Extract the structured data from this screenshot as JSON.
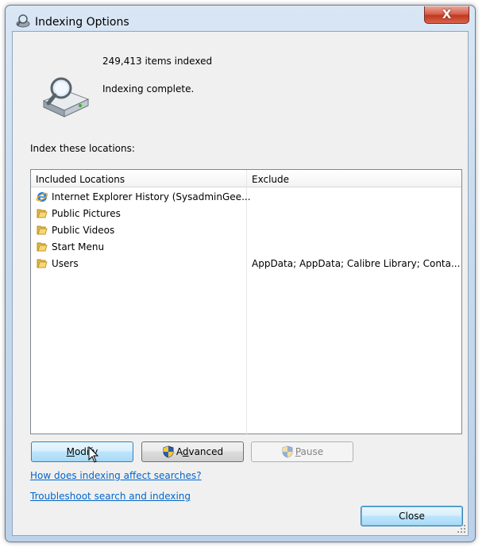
{
  "window": {
    "title": "Indexing Options",
    "close_glyph": "X"
  },
  "status": {
    "items_indexed": "249,413 items indexed",
    "message": "Indexing complete."
  },
  "locations_label": "Index these locations:",
  "table": {
    "columns": [
      "Included Locations",
      "Exclude"
    ],
    "rows": [
      {
        "icon": "ie-icon",
        "name": "Internet Explorer History (SysadminGee...",
        "exclude": ""
      },
      {
        "icon": "folder-icon",
        "name": "Public Pictures",
        "exclude": ""
      },
      {
        "icon": "folder-icon",
        "name": "Public Videos",
        "exclude": ""
      },
      {
        "icon": "folder-icon",
        "name": "Start Menu",
        "exclude": ""
      },
      {
        "icon": "folder-icon",
        "name": "Users",
        "exclude": "AppData; AppData; Calibre Library; Conta..."
      }
    ]
  },
  "buttons": {
    "modify_pre": "",
    "modify_u": "M",
    "modify_post": "odify",
    "advanced_pre": "A",
    "advanced_u": "d",
    "advanced_post": "vanced",
    "pause_pre": "",
    "pause_u": "P",
    "pause_post": "ause",
    "close": "Close"
  },
  "links": {
    "how": "How does indexing affect searches?",
    "troubleshoot": "Troubleshoot search and indexing"
  },
  "colors": {
    "link": "#0066cc",
    "close_button": "#c2381f",
    "frame": "#c9dbee"
  }
}
